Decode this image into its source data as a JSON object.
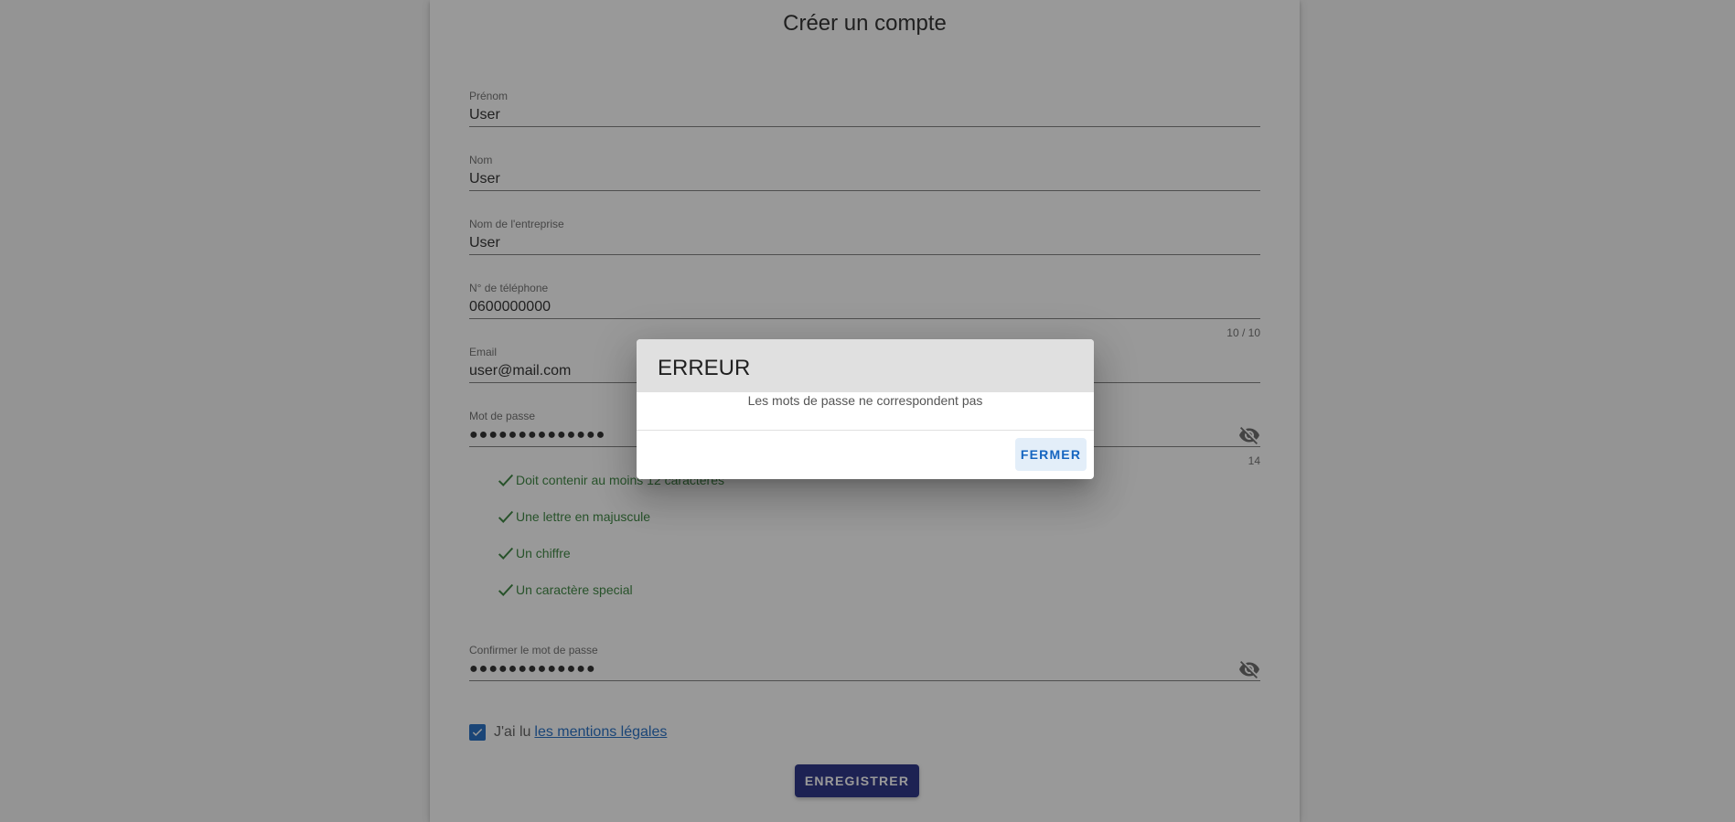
{
  "form": {
    "title": "Créer un compte",
    "fields": {
      "prenom": {
        "label": "Prénom",
        "value": "User"
      },
      "nom": {
        "label": "Nom",
        "value": "User"
      },
      "entreprise": {
        "label": "Nom de l'entreprise",
        "value": "User"
      },
      "telephone": {
        "label": "N° de téléphone",
        "value": "0600000000",
        "counter": "10 / 10"
      },
      "email": {
        "label": "Email",
        "value": "user@mail.com"
      },
      "password": {
        "label": "Mot de passe",
        "value": "●●●●●●●●●●●●●●",
        "counter": "14"
      },
      "confirm": {
        "label": "Confirmer le mot de passe",
        "value": "●●●●●●●●●●●●●"
      }
    },
    "password_rules": [
      "Doit contenir au moins 12 caractères",
      "Une lettre en majuscule",
      "Un chiffre",
      "Un caractère special"
    ],
    "legal": {
      "text": "J'ai lu",
      "link": "les mentions légales",
      "checked": true
    },
    "submit_label": "ENREGISTRER"
  },
  "dialog": {
    "title": "ERREUR",
    "message": "Les mots de passe ne correspondent pas",
    "close_label": "FERMER"
  },
  "colors": {
    "primary": "#1a237e",
    "accent": "#1565c0",
    "success": "#2e7d32",
    "overlay": "rgba(33,33,33,0.46)"
  },
  "icons": {
    "password_toggle": "eye-off-icon",
    "rule_check": "check-icon",
    "checkbox": "checkbox-checked-icon"
  }
}
